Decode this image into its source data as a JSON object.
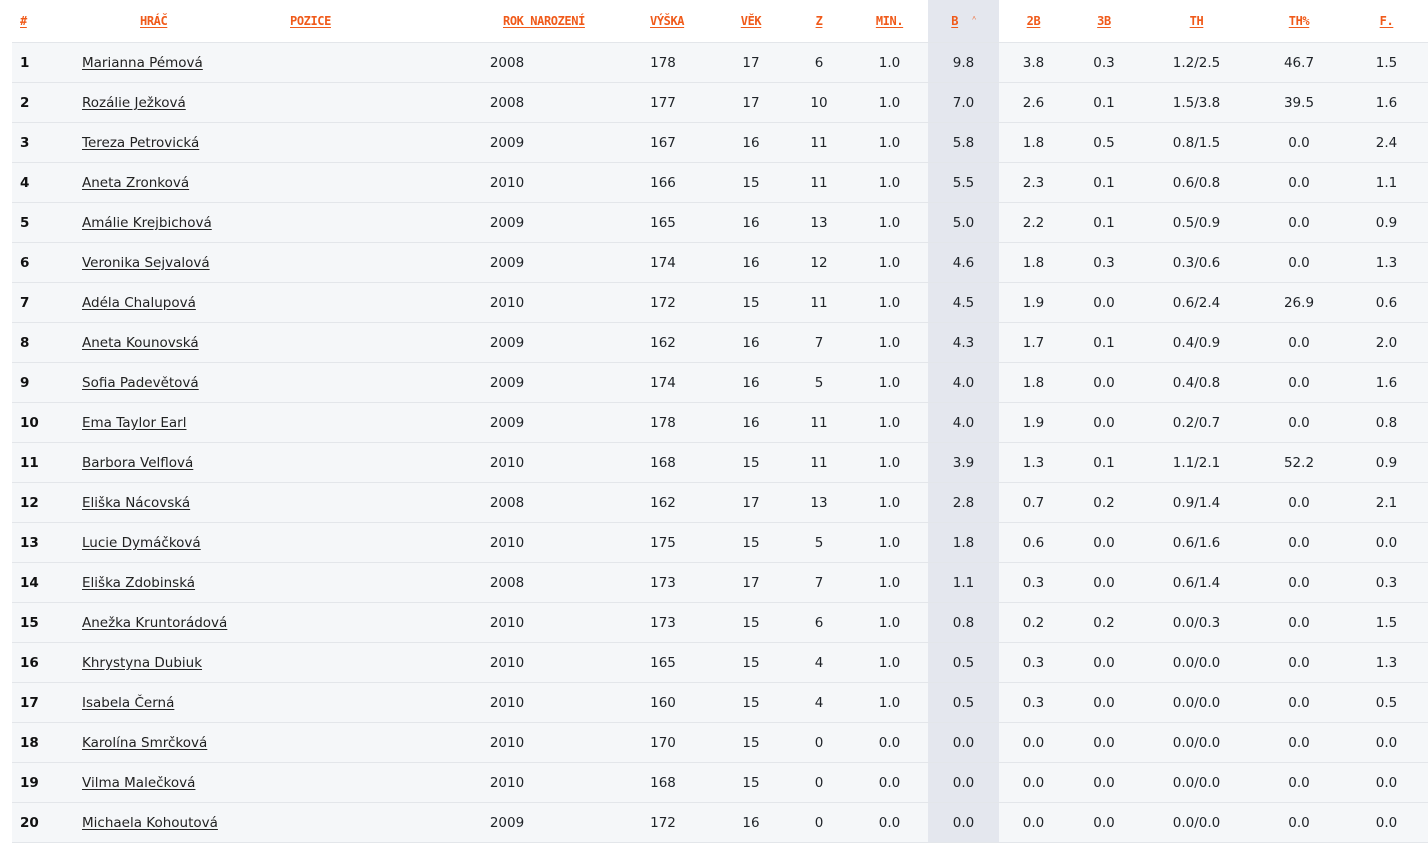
{
  "columns": [
    "#",
    "HRÁČ",
    "POZICE",
    "ROK NAROZENÍ",
    "VÝŠKA",
    "VĚK",
    "Z",
    "MIN.",
    "B",
    "2B",
    "3B",
    "TH",
    "TH%",
    "F."
  ],
  "sort_indicator": "˄",
  "rows": [
    {
      "rank": "1",
      "name": "Marianna Pémová",
      "pos": "",
      "year": "2008",
      "height": "178",
      "age": "17",
      "z": "6",
      "min": "1.0",
      "b": "9.8",
      "b2": "3.8",
      "b3": "0.3",
      "th": "1.2/2.5",
      "thp": "46.7",
      "f": "1.5"
    },
    {
      "rank": "2",
      "name": "Rozálie Ježková",
      "pos": "",
      "year": "2008",
      "height": "177",
      "age": "17",
      "z": "10",
      "min": "1.0",
      "b": "7.0",
      "b2": "2.6",
      "b3": "0.1",
      "th": "1.5/3.8",
      "thp": "39.5",
      "f": "1.6"
    },
    {
      "rank": "3",
      "name": "Tereza Petrovická",
      "pos": "",
      "year": "2009",
      "height": "167",
      "age": "16",
      "z": "11",
      "min": "1.0",
      "b": "5.8",
      "b2": "1.8",
      "b3": "0.5",
      "th": "0.8/1.5",
      "thp": "0.0",
      "f": "2.4"
    },
    {
      "rank": "4",
      "name": "Aneta Zronková",
      "pos": "",
      "year": "2010",
      "height": "166",
      "age": "15",
      "z": "11",
      "min": "1.0",
      "b": "5.5",
      "b2": "2.3",
      "b3": "0.1",
      "th": "0.6/0.8",
      "thp": "0.0",
      "f": "1.1"
    },
    {
      "rank": "5",
      "name": "Amálie Krejbichová",
      "pos": "",
      "year": "2009",
      "height": "165",
      "age": "16",
      "z": "13",
      "min": "1.0",
      "b": "5.0",
      "b2": "2.2",
      "b3": "0.1",
      "th": "0.5/0.9",
      "thp": "0.0",
      "f": "0.9"
    },
    {
      "rank": "6",
      "name": "Veronika Sejvalová",
      "pos": "",
      "year": "2009",
      "height": "174",
      "age": "16",
      "z": "12",
      "min": "1.0",
      "b": "4.6",
      "b2": "1.8",
      "b3": "0.3",
      "th": "0.3/0.6",
      "thp": "0.0",
      "f": "1.3"
    },
    {
      "rank": "7",
      "name": "Adéla Chalupová",
      "pos": "",
      "year": "2010",
      "height": "172",
      "age": "15",
      "z": "11",
      "min": "1.0",
      "b": "4.5",
      "b2": "1.9",
      "b3": "0.0",
      "th": "0.6/2.4",
      "thp": "26.9",
      "f": "0.6"
    },
    {
      "rank": "8",
      "name": "Aneta Kounovská",
      "pos": "",
      "year": "2009",
      "height": "162",
      "age": "16",
      "z": "7",
      "min": "1.0",
      "b": "4.3",
      "b2": "1.7",
      "b3": "0.1",
      "th": "0.4/0.9",
      "thp": "0.0",
      "f": "2.0"
    },
    {
      "rank": "9",
      "name": "Sofia Padevětová",
      "pos": "",
      "year": "2009",
      "height": "174",
      "age": "16",
      "z": "5",
      "min": "1.0",
      "b": "4.0",
      "b2": "1.8",
      "b3": "0.0",
      "th": "0.4/0.8",
      "thp": "0.0",
      "f": "1.6"
    },
    {
      "rank": "10",
      "name": "Ema Taylor Earl",
      "pos": "",
      "year": "2009",
      "height": "178",
      "age": "16",
      "z": "11",
      "min": "1.0",
      "b": "4.0",
      "b2": "1.9",
      "b3": "0.0",
      "th": "0.2/0.7",
      "thp": "0.0",
      "f": "0.8"
    },
    {
      "rank": "11",
      "name": "Barbora Velflová",
      "pos": "",
      "year": "2010",
      "height": "168",
      "age": "15",
      "z": "11",
      "min": "1.0",
      "b": "3.9",
      "b2": "1.3",
      "b3": "0.1",
      "th": "1.1/2.1",
      "thp": "52.2",
      "f": "0.9"
    },
    {
      "rank": "12",
      "name": "Eliška Nácovská",
      "pos": "",
      "year": "2008",
      "height": "162",
      "age": "17",
      "z": "13",
      "min": "1.0",
      "b": "2.8",
      "b2": "0.7",
      "b3": "0.2",
      "th": "0.9/1.4",
      "thp": "0.0",
      "f": "2.1"
    },
    {
      "rank": "13",
      "name": "Lucie Dymáčková",
      "pos": "",
      "year": "2010",
      "height": "175",
      "age": "15",
      "z": "5",
      "min": "1.0",
      "b": "1.8",
      "b2": "0.6",
      "b3": "0.0",
      "th": "0.6/1.6",
      "thp": "0.0",
      "f": "0.0"
    },
    {
      "rank": "14",
      "name": "Eliška Zdobinská",
      "pos": "",
      "year": "2008",
      "height": "173",
      "age": "17",
      "z": "7",
      "min": "1.0",
      "b": "1.1",
      "b2": "0.3",
      "b3": "0.0",
      "th": "0.6/1.4",
      "thp": "0.0",
      "f": "0.3"
    },
    {
      "rank": "15",
      "name": "Anežka Kruntorádová",
      "pos": "",
      "year": "2010",
      "height": "173",
      "age": "15",
      "z": "6",
      "min": "1.0",
      "b": "0.8",
      "b2": "0.2",
      "b3": "0.2",
      "th": "0.0/0.3",
      "thp": "0.0",
      "f": "1.5"
    },
    {
      "rank": "16",
      "name": "Khrystyna Dubiuk",
      "pos": "",
      "year": "2010",
      "height": "165",
      "age": "15",
      "z": "4",
      "min": "1.0",
      "b": "0.5",
      "b2": "0.3",
      "b3": "0.0",
      "th": "0.0/0.0",
      "thp": "0.0",
      "f": "1.3"
    },
    {
      "rank": "17",
      "name": "Isabela Černá",
      "pos": "",
      "year": "2010",
      "height": "160",
      "age": "15",
      "z": "4",
      "min": "1.0",
      "b": "0.5",
      "b2": "0.3",
      "b3": "0.0",
      "th": "0.0/0.0",
      "thp": "0.0",
      "f": "0.5"
    },
    {
      "rank": "18",
      "name": "Karolína Smrčková",
      "pos": "",
      "year": "2010",
      "height": "170",
      "age": "15",
      "z": "0",
      "min": "0.0",
      "b": "0.0",
      "b2": "0.0",
      "b3": "0.0",
      "th": "0.0/0.0",
      "thp": "0.0",
      "f": "0.0"
    },
    {
      "rank": "19",
      "name": "Vilma Malečková",
      "pos": "",
      "year": "2010",
      "height": "168",
      "age": "15",
      "z": "0",
      "min": "0.0",
      "b": "0.0",
      "b2": "0.0",
      "b3": "0.0",
      "th": "0.0/0.0",
      "thp": "0.0",
      "f": "0.0"
    },
    {
      "rank": "20",
      "name": "Michaela Kohoutová",
      "pos": "",
      "year": "2009",
      "height": "172",
      "age": "16",
      "z": "0",
      "min": "0.0",
      "b": "0.0",
      "b2": "0.0",
      "b3": "0.0",
      "th": "0.0/0.0",
      "thp": "0.0",
      "f": "0.0"
    }
  ],
  "colors": {
    "header_text": "#f05a1a",
    "sorted_column_bg": "#e4e7ee",
    "row_bg": "#f5f7f9"
  }
}
